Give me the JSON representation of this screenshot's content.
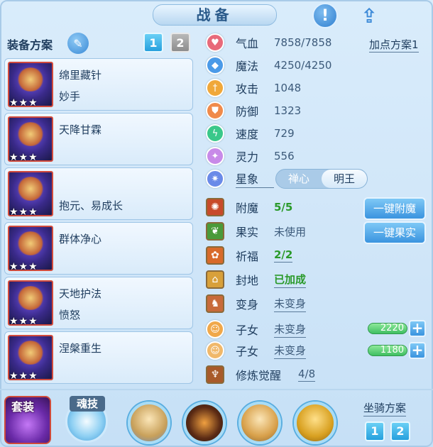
{
  "title": "战备",
  "icons": {
    "alert": "exclamation-icon",
    "share": "share-icon",
    "edit": "pencil-icon"
  },
  "left": {
    "plan_label": "装备方案",
    "plan_buttons": [
      "1",
      "2"
    ],
    "equipment": [
      {
        "line1": "绵里藏针",
        "line2": "妙手",
        "stars": "★★★"
      },
      {
        "line1": "天降甘霖",
        "line2": "",
        "stars": "★★★"
      },
      {
        "line1": "",
        "line2": "抱元、易成长",
        "stars": "★★★"
      },
      {
        "line1": "群体净心",
        "line2": "",
        "stars": "★★★"
      },
      {
        "line1": "天地护法",
        "line2": "愤怒",
        "stars": "★★★"
      },
      {
        "line1": "涅槃重生",
        "line2": "",
        "stars": "★★★"
      }
    ]
  },
  "stats": {
    "add_plan": "加点方案1",
    "hp": {
      "label": "气血",
      "value": "7858/7858"
    },
    "mp": {
      "label": "魔法",
      "value": "4250/4250"
    },
    "atk": {
      "label": "攻击",
      "value": "1048"
    },
    "def": {
      "label": "防御",
      "value": "1323"
    },
    "spd": {
      "label": "速度",
      "value": "729"
    },
    "spirit": {
      "label": "灵力",
      "value": "556"
    },
    "xiang": {
      "label": "星象",
      "opt1": "禅心",
      "opt2": "明王"
    },
    "enchant": {
      "label": "附魔",
      "value": "5/5",
      "button": "一键附魔"
    },
    "fruit": {
      "label": "果实",
      "value": "未使用",
      "button": "一键果实"
    },
    "bless": {
      "label": "祈福",
      "value": "2/2"
    },
    "seal": {
      "label": "封地",
      "value": "已加成"
    },
    "transform": {
      "label": "变身",
      "value": "未变身"
    },
    "child1": {
      "label": "子女",
      "value": "未变身",
      "bar": "2220"
    },
    "child2": {
      "label": "子女",
      "value": "未变身",
      "bar": "1180"
    },
    "cultivate": {
      "label": "修炼觉醒",
      "value": "4/8"
    }
  },
  "bottom": {
    "suit_label": "套装",
    "soul_label": "魂技",
    "mount_label": "坐骑方案",
    "mount_buttons": [
      "1",
      "2"
    ]
  },
  "colors": {
    "accent": "#3a94df",
    "green": "#2a9a2a",
    "frame": "#a9cbe8"
  }
}
